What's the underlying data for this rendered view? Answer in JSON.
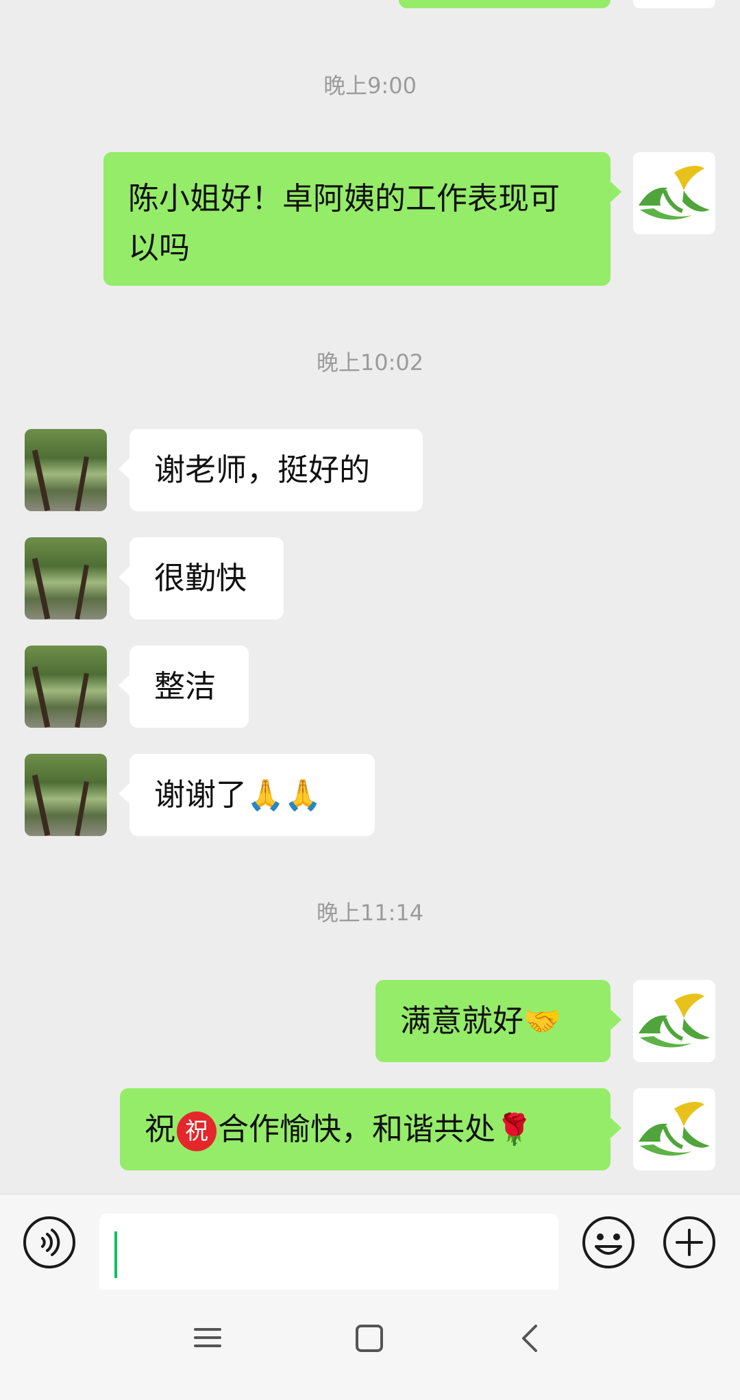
{
  "chat": {
    "timestamps": [
      "晚上9:00",
      "晚上10:02",
      "晚上11:14"
    ],
    "messages": [
      {
        "from": "me",
        "text": "陈小姐好！卓阿姨的工作表现可以吗"
      },
      {
        "from": "them",
        "text": "谢老师，挺好的"
      },
      {
        "from": "them",
        "text": "很勤快"
      },
      {
        "from": "them",
        "text": "整洁"
      },
      {
        "from": "them",
        "text": "谢谢了",
        "emoji": "🙏🙏"
      },
      {
        "from": "me",
        "text": "满意就好",
        "emoji": "🤝"
      },
      {
        "from": "me",
        "text_before": "祝",
        "text_after": "合作愉快，和谐共处",
        "badge": "祝",
        "emoji": "🌹"
      }
    ]
  },
  "input_bar": {
    "icons": [
      "voice-icon",
      "emoji-icon",
      "plus-icon"
    ]
  },
  "nav": {
    "icons": [
      "menu-icon",
      "home-icon",
      "back-icon"
    ]
  },
  "colors": {
    "background": "#EDEDED",
    "outgoing_bubble": "#95EC69",
    "incoming_bubble": "#FFFFFF",
    "cursor": "#07C160",
    "badge": "#E5262A"
  }
}
